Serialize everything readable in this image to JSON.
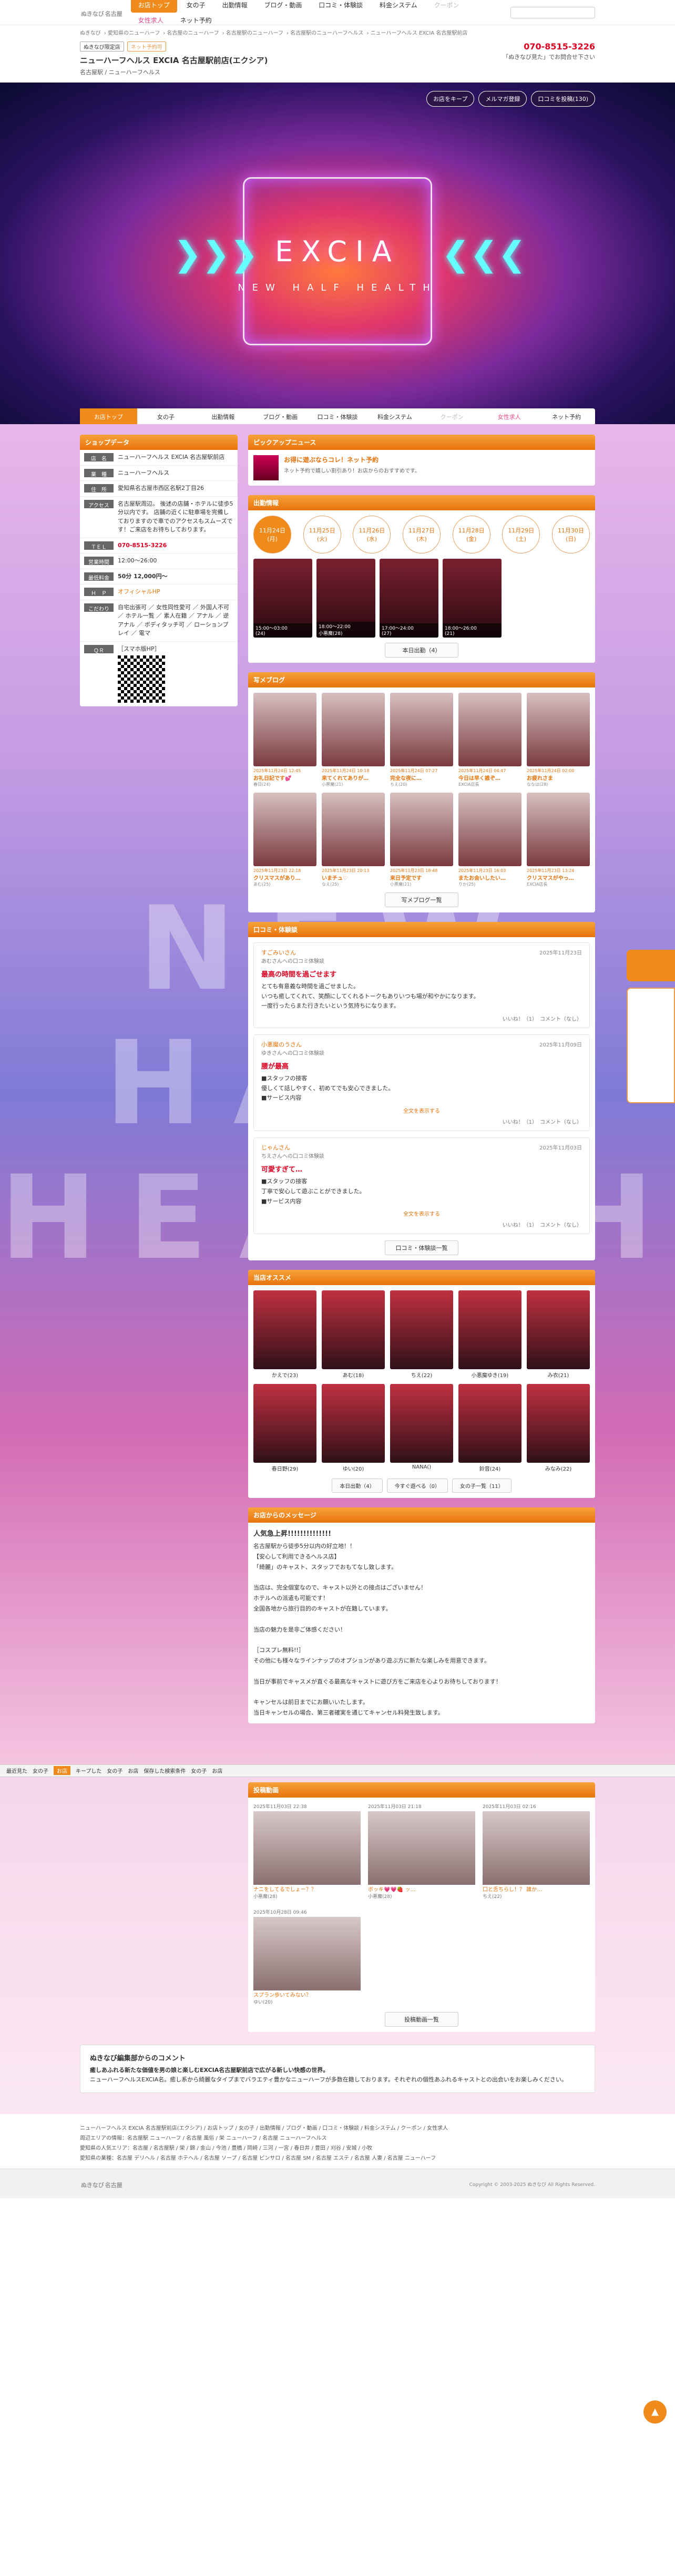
{
  "site": {
    "logo": "ぬきなび",
    "logo_area": "名古屋",
    "search_placeholder": ""
  },
  "gnav": [
    "お店トップ",
    "女の子",
    "出勤情報",
    "ブログ・動画",
    "口コミ・体験談",
    "料金システム",
    "クーポン",
    "女性求人",
    "ネット予約"
  ],
  "breadcrumb": [
    "ぬきなび",
    "愛知県のニューハーフ",
    "名古屋のニューハーフ",
    "名古屋駅のニューハーフ",
    "名古屋駅のニューハーフヘルス",
    "ニューハーフヘルス EXCIA 名古屋駅前店"
  ],
  "shop": {
    "tags": [
      "ぬきなび限定店",
      "ネット予約可"
    ],
    "name": "ニューハーフヘルス EXCIA 名古屋駅前店(エクシア)",
    "sub": "名古屋駅 / ニューハーフヘルス",
    "tel": "070-8515-3226",
    "tel_note": "「ぬきなび見た」でお問合せ下さい"
  },
  "hero": {
    "brand": "EXCIA",
    "tagline": "NEW HALF HEALTH",
    "buttons": [
      "お店をキープ",
      "メルマガ登録",
      "口コミを投稿(130)"
    ]
  },
  "shopdata": {
    "title": "ショップデータ",
    "rows": [
      {
        "k": "店　名",
        "v": "ニューハーフヘルス EXCIA 名古屋駅前店"
      },
      {
        "k": "業　種",
        "v": "ニューハーフヘルス"
      },
      {
        "k": "住　所",
        "v": "愛知県名古屋市西区名駅2丁目26"
      },
      {
        "k": "アクセス",
        "v": "名古屋駅周辺。 後述の店舗・ホテルに徒歩5分以内です。 店舗の近くに駐車場を完備しておりますので車でのアクセスもスムーズです！ご来店をお待ちしております。"
      },
      {
        "k": "ＴＥＬ",
        "v": "070-8515-3226"
      },
      {
        "k": "営業時間",
        "v": "12:00〜26:00"
      },
      {
        "k": "最低料金",
        "v": "50分 12,000円〜"
      },
      {
        "k": "Ｈ　Ｐ",
        "v": "オフィシャルHP"
      },
      {
        "k": "こだわり",
        "v": "自宅出張可 ／ 女性同性愛可 ／ 外国人不可 ／ ホテル一覧 ／ 素人在籍 ／ アナル ／ 逆アナル ／ ボディタッチ可 ／ ローションプレイ ／ 電マ"
      },
      {
        "k": "ＱＲ",
        "v": "［スマホ版HP］"
      }
    ]
  },
  "pickup": {
    "title": "ピックアップニュース",
    "headline": "お得に遊ぶならコレ！ネット予約",
    "body": "ネット予約で嬉しい割引あり！お店からのおすすめです。"
  },
  "schedule": {
    "title": "出勤情報",
    "days": [
      {
        "d": "11月24日",
        "w": "(月)"
      },
      {
        "d": "11月25日",
        "w": "(火)"
      },
      {
        "d": "11月26日",
        "w": "(水)"
      },
      {
        "d": "11月27日",
        "w": "(木)"
      },
      {
        "d": "11月28日",
        "w": "(金)"
      },
      {
        "d": "11月29日",
        "w": "(土)"
      },
      {
        "d": "11月30日",
        "w": "(日)"
      }
    ],
    "girls": [
      {
        "t": "15:00〜03:00",
        "n": "(24)"
      },
      {
        "t": "18:00〜22:00",
        "n": "小悪魔(28)"
      },
      {
        "t": "17:00〜24:00",
        "n": "(27)"
      },
      {
        "t": "18:00〜26:00",
        "n": "(21)"
      }
    ],
    "more": "本日出勤（4）"
  },
  "blog": {
    "title": "写メブログ",
    "items": [
      {
        "dt": "2025年11月24日 12:45",
        "tt": "お礼日記です💕",
        "au": "春日(24)"
      },
      {
        "dt": "2025年11月24日 10:18",
        "tt": "来てくれてありが…",
        "au": "小悪魔(21)"
      },
      {
        "dt": "2025年11月24日 07:27",
        "tt": "完全な夜に…",
        "au": "ちえ(20)"
      },
      {
        "dt": "2025年11月24日 04:47",
        "tt": "今日は早く誰ぞ…",
        "au": "EXCIA店長"
      },
      {
        "dt": "2025年11月24日 02:00",
        "tt": "お疲れさま",
        "au": "ななは(28)"
      },
      {
        "dt": "2025年11月23日 22:18",
        "tt": "クリスマスがあり…",
        "au": "あむ(25)"
      },
      {
        "dt": "2025年11月23日 20:13",
        "tt": "いまチュ♡",
        "au": "なえ(25)"
      },
      {
        "dt": "2025年11月23日 18:48",
        "tt": "来日予定です",
        "au": "小悪魔(21)"
      },
      {
        "dt": "2025年11月23日 16:03",
        "tt": "またお会いしたい…",
        "au": "りか(25)"
      },
      {
        "dt": "2025年11月23日 13:24",
        "tt": "クリスマスがやっ…",
        "au": "EXCIA店長"
      }
    ],
    "more": "写メブログ一覧"
  },
  "reviews": {
    "title": "口コミ・体験談",
    "items": [
      {
        "who": "すごみいさん",
        "sub": "あむさんへの口コミ体験談",
        "date": "2025年11月23日",
        "tt": "最高の時間を過ごせます",
        "tx": "とても有意義な時間を過ごせました。\nいつも癒してくれて、笑顔にしてくれるトークもありいつも場が和やかになります。\n一度行ったらまた行きたいという気持ちになります。",
        "act": "いいね！（1）　コメント（なし）"
      },
      {
        "who": "小悪魔のうさん",
        "sub": "ゆきさんへの口コミ体験談",
        "date": "2025年11月09日",
        "tt": "腰が最高",
        "tx": "■スタッフの接客\n優しくて話しやすく、初めてでも安心できました。\n■サービス内容",
        "act": "いいね！（1）　コメント（なし）"
      },
      {
        "who": "じゃんさん",
        "sub": "ちえさんへの口コミ体験談",
        "date": "2025年11月03日",
        "tt": "可愛すぎて…",
        "tx": "■スタッフの接客\n丁寧で安心して遊ぶことができました。\n■サービス内容",
        "act": "いいね！（1）　コメント（なし）"
      }
    ],
    "open": "全文を表示する",
    "more": "口コミ・体験談一覧"
  },
  "recommend": {
    "title": "当店オススメ",
    "girls": [
      "かえで(23)",
      "あむ(18)",
      "ちえ(22)",
      "小悪魔ゆき(19)",
      "み衣(21)",
      "春日野(29)",
      "ゆい(20)",
      "NANA()",
      "鈴音(24)",
      "みなみ(22)"
    ],
    "buttons": [
      "本日出勤（4）",
      "今すぐ遊べる（0）",
      "女の子一覧（11）"
    ]
  },
  "message": {
    "title": "お店からのメッセージ",
    "lead": "人気急上昇!!!!!!!!!!!!!!",
    "body": "名古屋駅から徒歩5分以内の好立地！！\n【安心して利用できるヘルス店】\n「綺麗」のキャスト、スタッフでおもてなし致します。\n\n当店は、完全個室なので、キャスト以外との接点はございません！\nホテルへの派遣も可能です！\n全国各地から旅行目的のキャストが在籍しています。\n\n当店の魅力を是非ご体感ください！\n\n［コスプレ無料!!］\nその他にも様々なラインナップのオプションがあり遊ぶ方に新たな楽しみを用意できます。\n\n当日が事前でキャスメが直ぐる最高なキャストに遊び方をご来店を心よりお待ちしております！\n\nキャンセルは前日までにお願いいたします。\n当日キャンセルの場合、第三者確実を通じてキャンセル料発生致します。"
  },
  "sticky": [
    "最近見た",
    "女の子",
    "お店",
    "キープした",
    "女の子",
    "お店",
    "保存した検索条件",
    "女の子",
    "お店"
  ],
  "photos": {
    "title": "投稿動画",
    "items": [
      {
        "dt": "2025年11月03日 22:38",
        "tt": "ナニをしてるでしょー？？",
        "au": "小悪魔(28)"
      },
      {
        "dt": "2025年11月03日 21:18",
        "tt": "ボッキ💗💗🍓 ッ…",
        "au": "小悪魔(28)"
      },
      {
        "dt": "2025年11月03日 02:16",
        "tt": "口と舌ちらし！？ 誰か…",
        "au": "ちえ(22)"
      },
      {
        "dt": "2025年10月28日 09:46",
        "tt": "スプラン歩いてみない？",
        "au": "ゆい(20)"
      }
    ],
    "more": "投稿動画一覧"
  },
  "editor": {
    "title": "ぬきなび編集部からのコメント",
    "lead": "癒しあふれる新たな価値を男の娘と楽しむEXCIA名古屋駅前店で広がる新しい快感の世界。",
    "body": "ニューハーフヘルスEXCIA名。癒し系から綺麗なタイプまでバラエティ豊かなニューハーフが多数在籍しております。それぞれの個性あふれるキャストとの出会いをお楽しみください。"
  },
  "footer": {
    "line1": "ニューハーフヘルス EXCIA 名古屋駅前店(エクシア) / お店トップ / 女の子 / 出勤情報 / ブログ・動画 / 口コミ・体験談 / 料金システム / クーポン / 女性求人",
    "line2": "周辺エリアの情報：名古屋駅 ニューハーフ / 名古屋 風俗 / 栄 ニューハーフ / 名古屋 ニューハーフヘルス",
    "line3": "愛知県の人気エリア：名古屋 / 名古屋駅 / 栄 / 錦 / 金山 / 今池 / 豊橋 / 岡崎 / 三河 / 一宮 / 春日井 / 豊田 / 刈谷 / 安城 / 小牧",
    "line4": "愛知県の業種：名古屋 デリヘル / 名古屋 ホテヘル / 名古屋 ソープ / 名古屋 ピンサロ / 名古屋 SM / 名古屋 エステ / 名古屋 人妻 / 名古屋 ニューハーフ",
    "copy": "Copyright © 2003-2025 ぬきなび All Rights Reserved."
  }
}
